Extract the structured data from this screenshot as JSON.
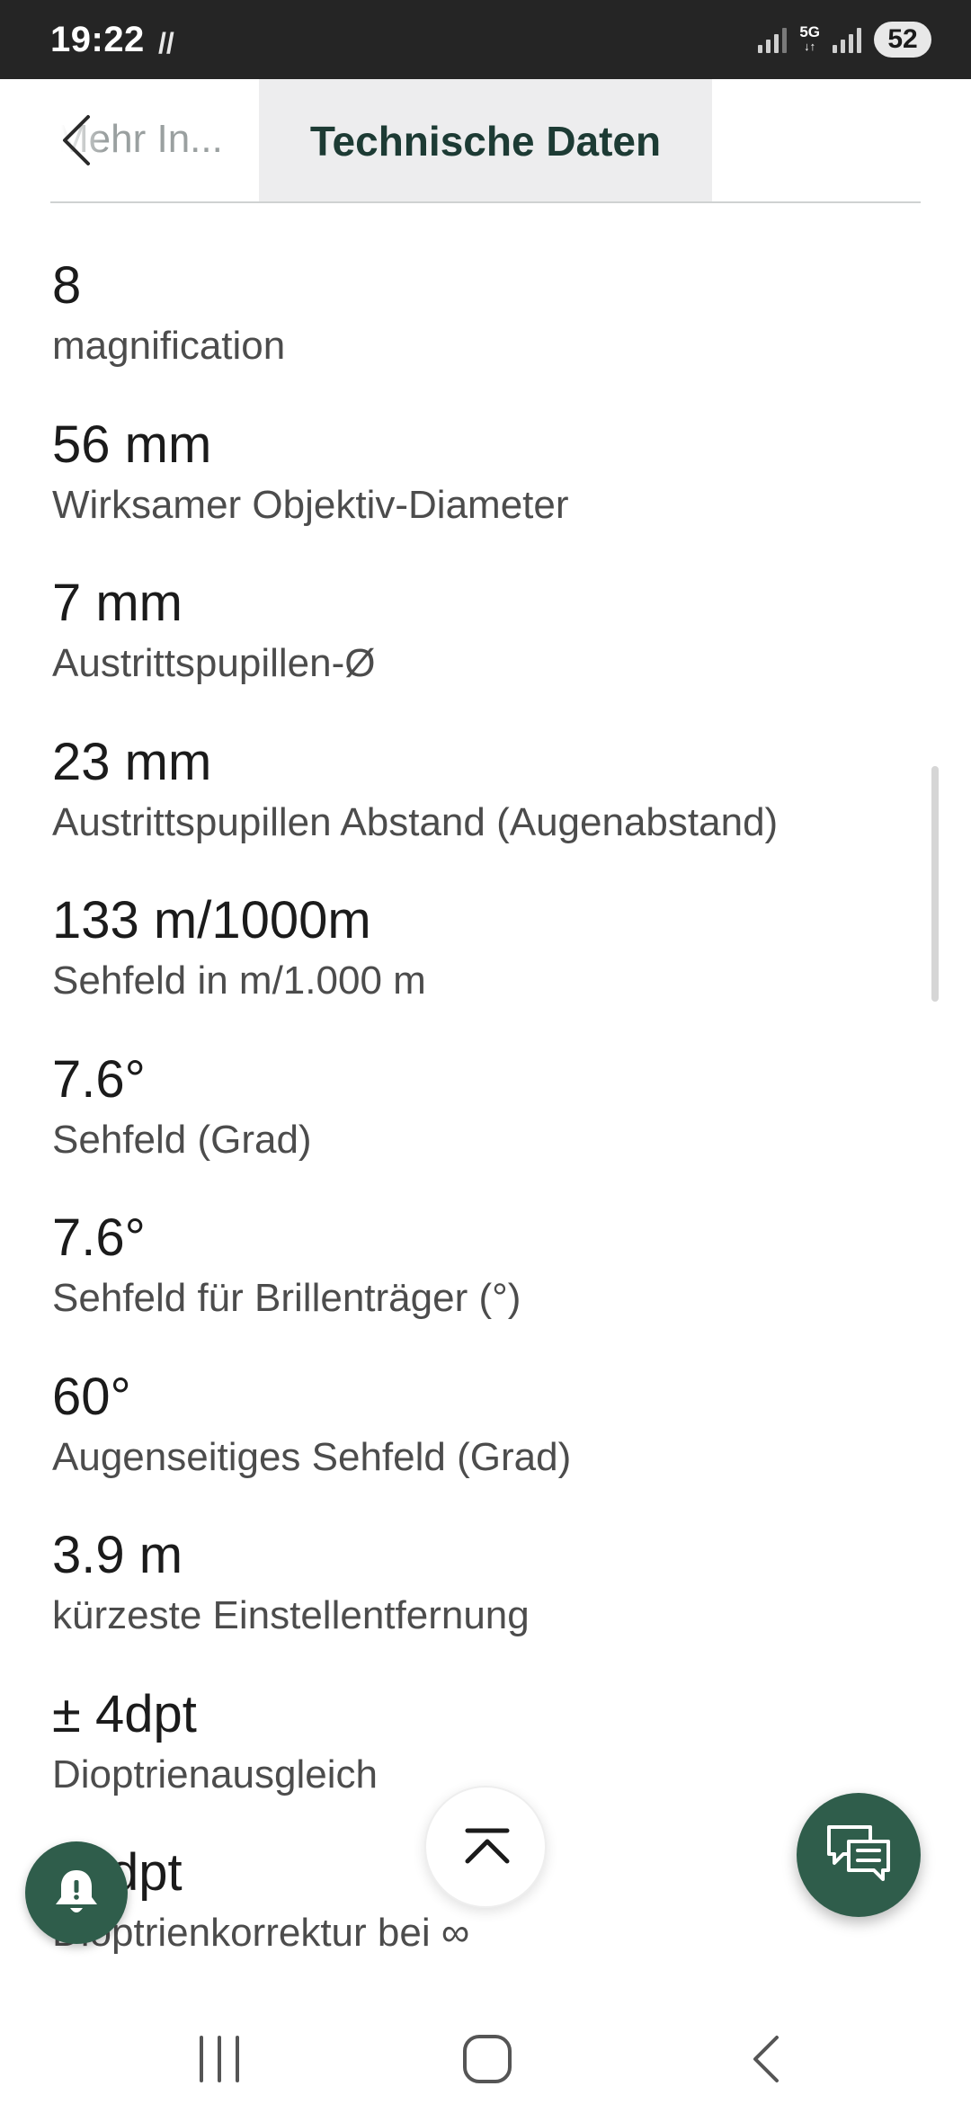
{
  "status_bar": {
    "time": "19:22",
    "misc_icon": "//",
    "network_label": "5G",
    "battery": "52"
  },
  "tabs": {
    "previous_label": "Mehr In...",
    "active_label": "Technische Daten"
  },
  "specs": [
    {
      "value": "8",
      "label": "magnification"
    },
    {
      "value": "56 mm",
      "label": "Wirksamer Objektiv-Diameter"
    },
    {
      "value": "7 mm",
      "label": "Austrittspupillen-Ø"
    },
    {
      "value": "23 mm",
      "label": "Austrittspupillen Abstand (Augenabstand)"
    },
    {
      "value": "133 m/1000m",
      "label": "Sehfeld in m/1.000 m"
    },
    {
      "value": "7.6°",
      "label": "Sehfeld (Grad)"
    },
    {
      "value": "7.6°",
      "label": "Sehfeld für Brillenträger (°)"
    },
    {
      "value": "60°",
      "label": "Augenseitiges Sehfeld (Grad)"
    },
    {
      "value": "3.9 m",
      "label": "kürzeste Einstellentfernung"
    },
    {
      "value": "± 4dpt",
      "label": "Dioptrienausgleich"
    },
    {
      "value": "dpt",
      "label": "Dioptrienkorrektur bei ∞"
    }
  ],
  "colors": {
    "accent": "#2f5d4b",
    "tab_text": "#1d3b34",
    "status_bar": "#252525"
  },
  "icons": {
    "back": "chevron-left-icon",
    "notify": "bell-icon",
    "scroll_top": "arrow-up-icon",
    "chat": "chat-bubbles-icon"
  }
}
